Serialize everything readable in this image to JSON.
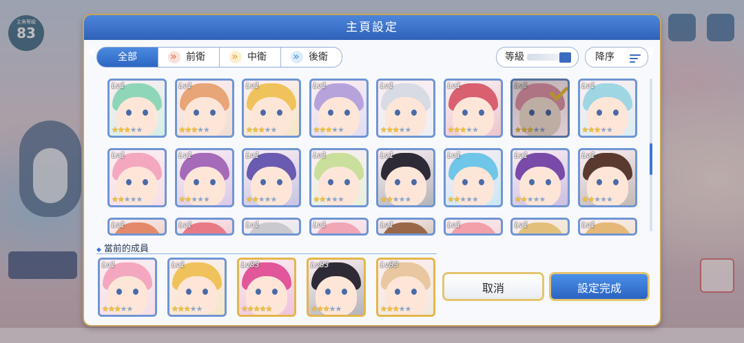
{
  "dialog": {
    "title": "主頁設定",
    "tabs": [
      {
        "label": "全部",
        "icon": "none",
        "active": true
      },
      {
        "label": "前衛",
        "icon": "front-role-icon",
        "active": false
      },
      {
        "label": "中衛",
        "icon": "middle-role-icon",
        "active": false
      },
      {
        "label": "後衛",
        "icon": "back-role-icon",
        "active": false
      }
    ],
    "sort_field_label": "等級",
    "sort_order_label": "降序",
    "current_members_label": "當前的成員",
    "cancel_label": "取消",
    "confirm_label": "設定完成"
  },
  "roster": [
    {
      "level": "Lv1",
      "stars": 3,
      "hair": "#8fd6b8",
      "skin": "#fde6d8",
      "selected": false
    },
    {
      "level": "Lv1",
      "stars": 3,
      "hair": "#e8a577",
      "skin": "#fde6d8",
      "selected": false
    },
    {
      "level": "Lv1",
      "stars": 3,
      "hair": "#f0c25c",
      "skin": "#fde6d8",
      "selected": false
    },
    {
      "level": "Lv1",
      "stars": 3,
      "hair": "#b7a3dc",
      "skin": "#fde6d8",
      "selected": false
    },
    {
      "level": "Lv1",
      "stars": 3,
      "hair": "#d8dbe4",
      "skin": "#fde6d8",
      "selected": false
    },
    {
      "level": "Lv1",
      "stars": 3,
      "hair": "#d9606e",
      "skin": "#fde6d8",
      "selected": false
    },
    {
      "level": "Lv1",
      "stars": 3,
      "hair": "#e99bb0",
      "skin": "#fde6d8",
      "selected": true
    },
    {
      "level": "Lv1",
      "stars": 3,
      "hair": "#9fd6e3",
      "skin": "#fde6d8",
      "selected": false
    },
    {
      "level": "Lv1",
      "stars": 2,
      "hair": "#f4a8bf",
      "skin": "#fde6d8",
      "selected": false
    },
    {
      "level": "Lv1",
      "stars": 2,
      "hair": "#a56ab8",
      "skin": "#fde6d8",
      "selected": false
    },
    {
      "level": "Lv1",
      "stars": 2,
      "hair": "#6a5bb0",
      "skin": "#fde6d8",
      "selected": false
    },
    {
      "level": "Lv1",
      "stars": 2,
      "hair": "#c9df9b",
      "skin": "#fde6d8",
      "selected": false
    },
    {
      "level": "Lv1",
      "stars": 2,
      "hair": "#2e2a36",
      "skin": "#fde6d8",
      "selected": false
    },
    {
      "level": "Lv1",
      "stars": 2,
      "hair": "#6fc6e8",
      "skin": "#fde6d8",
      "selected": false
    },
    {
      "level": "Lv1",
      "stars": 2,
      "hair": "#7a4aa8",
      "skin": "#fde6d8",
      "selected": false
    },
    {
      "level": "Lv1",
      "stars": 2,
      "hair": "#5a3a2e",
      "skin": "#fde6d8",
      "selected": false
    },
    {
      "level": "Lv1",
      "stars": 0,
      "hair": "#e48a6a",
      "skin": "#fde6d8",
      "selected": false
    },
    {
      "level": "Lv1",
      "stars": 0,
      "hair": "#e87a86",
      "skin": "#fde6d8",
      "selected": false
    },
    {
      "level": "Lv1",
      "stars": 0,
      "hair": "#c9c9cf",
      "skin": "#fde6d8",
      "selected": false
    },
    {
      "level": "Lv1",
      "stars": 0,
      "hair": "#f1a6b6",
      "skin": "#fde6d8",
      "selected": false
    },
    {
      "level": "Lv1",
      "stars": 0,
      "hair": "#9a6848",
      "skin": "#fde6d8",
      "selected": false
    },
    {
      "level": "Lv1",
      "stars": 0,
      "hair": "#f2a0aa",
      "skin": "#fde6d8",
      "selected": false
    },
    {
      "level": "Lv1",
      "stars": 0,
      "hair": "#e3c07a",
      "skin": "#fde6d8",
      "selected": false
    },
    {
      "level": "Lv1",
      "stars": 0,
      "hair": "#e6b878",
      "skin": "#fde6d8",
      "selected": false
    }
  ],
  "members": [
    {
      "level": "Lv1",
      "stars": 3,
      "hair": "#f4a8bf",
      "skin": "#fde6d8",
      "frame": "silver"
    },
    {
      "level": "Lv1",
      "stars": 3,
      "hair": "#f0c25c",
      "skin": "#fde6d8",
      "frame": "silver"
    },
    {
      "level": "Lv83",
      "stars": 5,
      "hair": "#e2569a",
      "skin": "#fde6d8",
      "frame": "gold"
    },
    {
      "level": "Lv83",
      "stars": 3,
      "hair": "#2e2a36",
      "skin": "#fde6d8",
      "frame": "gold"
    },
    {
      "level": "Lv83",
      "stars": 3,
      "hair": "#e9c7a0",
      "skin": "#fde6d8",
      "frame": "gold"
    }
  ],
  "background": {
    "player_level_label": "主角等級",
    "player_level": "83"
  }
}
